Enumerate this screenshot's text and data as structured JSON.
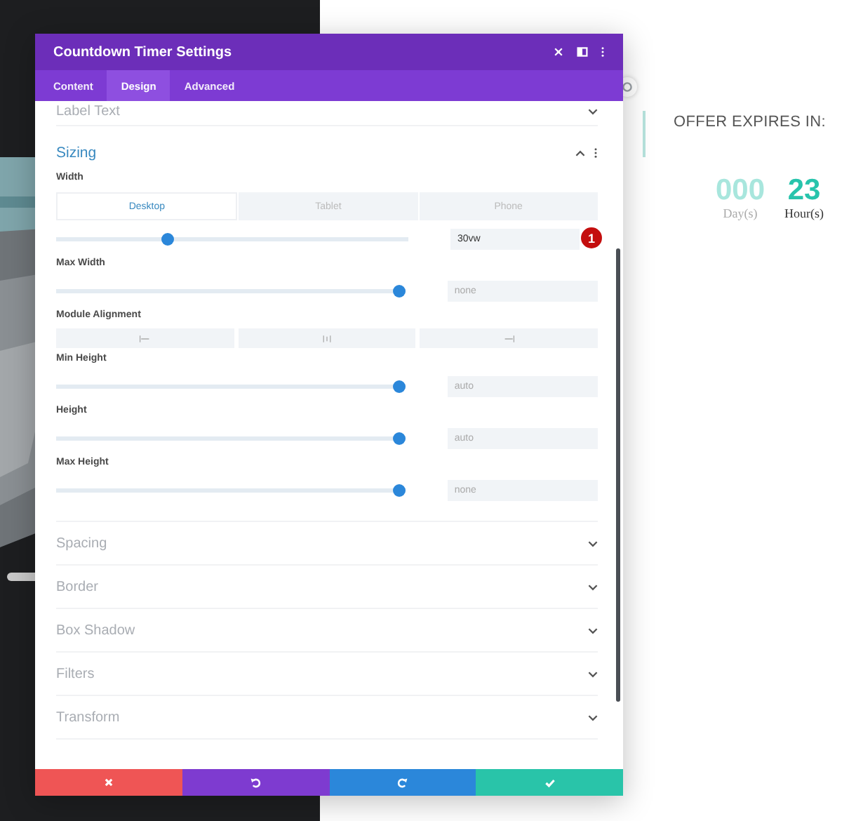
{
  "window": {
    "title": "Countdown Timer Settings"
  },
  "tabs": [
    {
      "label": "Content",
      "selected": false
    },
    {
      "label": "Design",
      "selected": true
    },
    {
      "label": "Advanced",
      "selected": false
    }
  ],
  "top_section": {
    "title": "Label Text",
    "expanded": false
  },
  "sizing": {
    "title": "Sizing",
    "expanded": true,
    "fields": [
      {
        "kind": "slider",
        "label": "Width",
        "devices": [
          {
            "label": "Desktop",
            "selected": true
          },
          {
            "label": "Tablet",
            "selected": false
          },
          {
            "label": "Phone",
            "selected": false
          }
        ],
        "level": 0.31,
        "value": "30vw",
        "badge": "1"
      },
      {
        "kind": "slider",
        "label": "Max Width",
        "level": 1,
        "placeholder": "none"
      },
      {
        "kind": "alignment",
        "label": "Module Alignment",
        "options": [
          {
            "kind": "left"
          },
          {
            "kind": "center"
          },
          {
            "kind": "right"
          }
        ]
      },
      {
        "kind": "slider",
        "label": "Min Height",
        "level": 1,
        "placeholder": "auto"
      },
      {
        "kind": "slider",
        "label": "Height",
        "level": 1,
        "placeholder": "auto"
      },
      {
        "kind": "slider",
        "label": "Max Height",
        "level": 1,
        "placeholder": "none"
      }
    ]
  },
  "sections": [
    {
      "title": "Spacing",
      "expanded": false
    },
    {
      "title": "Border",
      "expanded": false
    },
    {
      "title": "Box Shadow",
      "expanded": false
    },
    {
      "title": "Filters",
      "expanded": false
    },
    {
      "title": "Transform",
      "expanded": false
    }
  ],
  "footer_buttons": [
    {
      "kind": "discard"
    },
    {
      "kind": "undo"
    },
    {
      "kind": "redo"
    },
    {
      "kind": "save"
    }
  ],
  "preview": {
    "heading": "OFFER EXPIRES IN:",
    "units": [
      {
        "value": "000",
        "label": "Day(s)",
        "muted": true
      },
      {
        "value": "23",
        "label": "Hour(s)",
        "muted": false
      }
    ]
  }
}
